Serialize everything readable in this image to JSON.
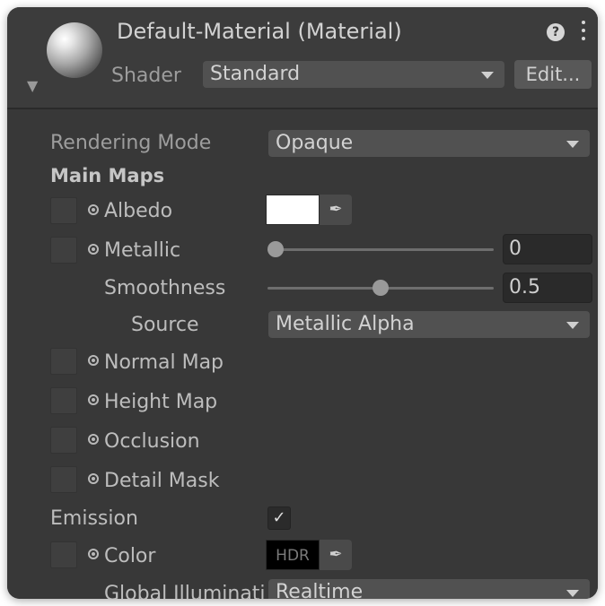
{
  "header": {
    "material_title": "Default-Material (Material)",
    "help_icon": "?",
    "menu_icon": "more-vertical-icon",
    "shader_label": "Shader",
    "shader_value": "Standard",
    "edit_button": "Edit..."
  },
  "properties": {
    "rendering_mode_label": "Rendering Mode",
    "rendering_mode_value": "Opaque",
    "main_maps_title": "Main Maps",
    "albedo_label": "Albedo",
    "albedo_color": "#ffffff",
    "metallic_label": "Metallic",
    "metallic_value": "0",
    "metallic_level": 0,
    "smoothness_label": "Smoothness",
    "smoothness_value": "0.5",
    "smoothness_level": 0.5,
    "source_label": "Source",
    "source_value": "Metallic Alpha",
    "normal_map_label": "Normal Map",
    "height_map_label": "Height Map",
    "occlusion_label": "Occlusion",
    "detail_mask_label": "Detail Mask",
    "emission_label": "Emission",
    "emission_checked": true,
    "emission_check_glyph": "✓",
    "color_label": "Color",
    "color_swatch_text": "HDR",
    "global_illum_label": "Global Illuminati",
    "global_illum_value": "Realtime",
    "eyedropper_glyph": "✒"
  },
  "colors": {
    "panel_bg": "#383838",
    "field_bg": "#515151",
    "text": "#c4c4c4"
  }
}
